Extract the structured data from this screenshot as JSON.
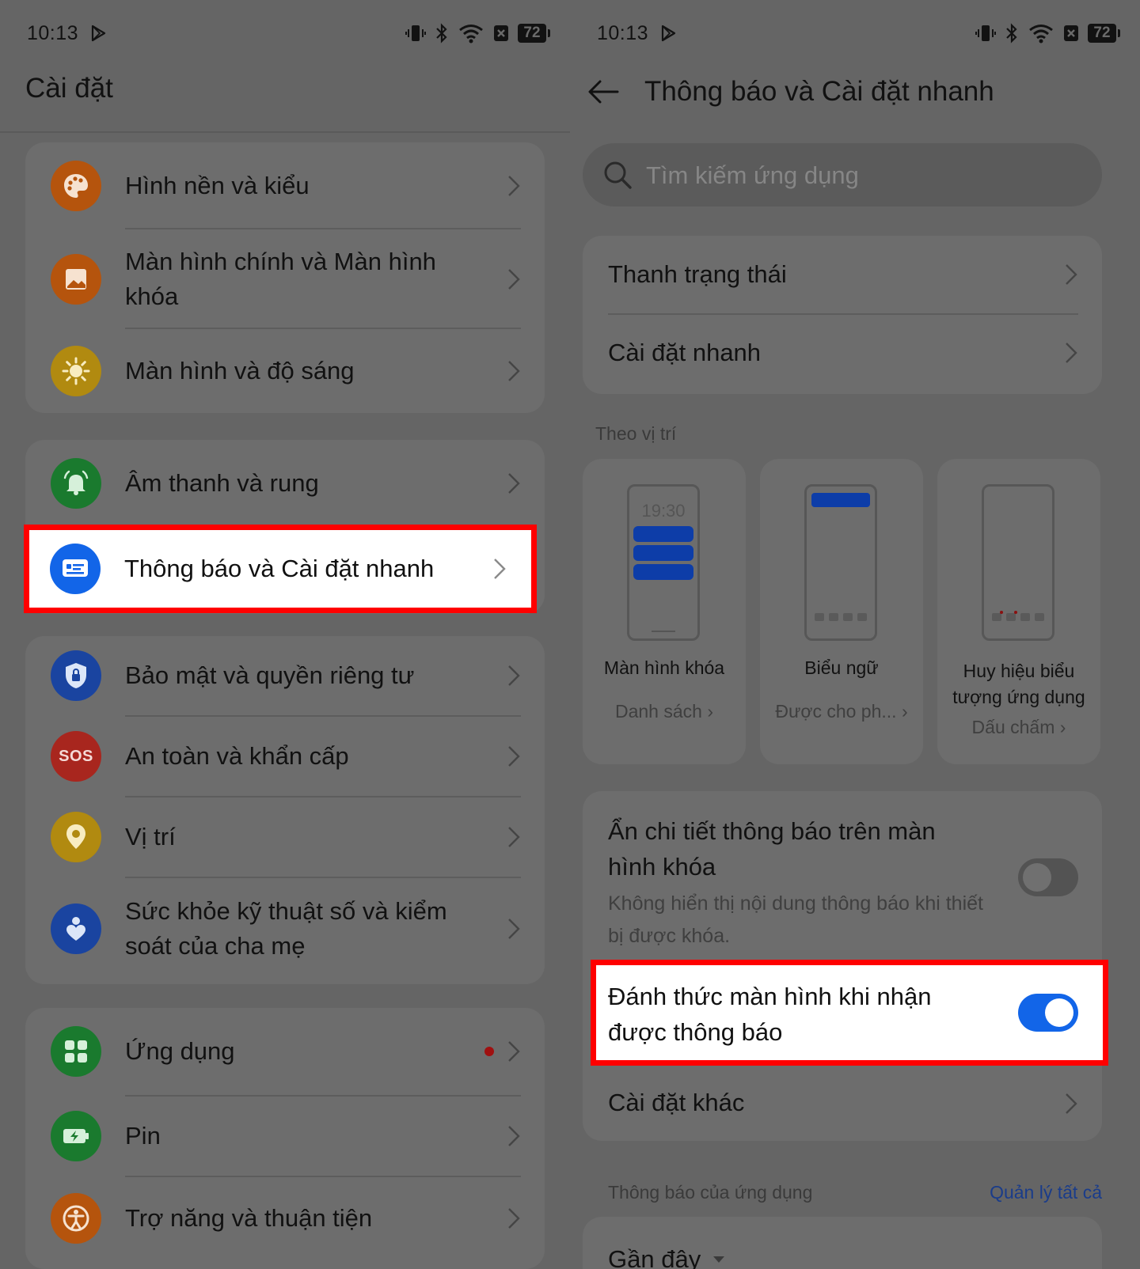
{
  "status": {
    "time": "10:13",
    "battery": "72"
  },
  "left": {
    "title": "Cài đặt",
    "group1": [
      {
        "label": "Hình nền và kiểu",
        "icon": "palette-icon",
        "color": "#b5540d"
      },
      {
        "label": "Màn hình chính và Màn hình khóa",
        "icon": "picture-icon",
        "color": "#b5540d"
      },
      {
        "label": "Màn hình và độ sáng",
        "icon": "sun-icon",
        "color": "#b18a10"
      }
    ],
    "group2": [
      {
        "label": "Âm thanh và rung",
        "icon": "bell-icon",
        "color": "#1a7a2e"
      },
      {
        "label": "Thông báo và Cài đặt nhanh",
        "icon": "notification-icon",
        "color": "#1265e8"
      }
    ],
    "group3": [
      {
        "label": "Bảo mật và quyền riêng tư",
        "icon": "shield-lock-icon",
        "color": "#1a44a0"
      },
      {
        "label": "An toàn và khẩn cấp",
        "icon": "sos-icon",
        "color": "#a8261e",
        "icon_text": "SOS"
      },
      {
        "label": "Vị trí",
        "icon": "location-pin-icon",
        "color": "#b18a10"
      },
      {
        "label": "Sức khỏe kỹ thuật số và kiểm soát của cha mẹ",
        "icon": "heart-person-icon",
        "color": "#1a44a0"
      }
    ],
    "group4": [
      {
        "label": "Ứng dụng",
        "icon": "apps-grid-icon",
        "color": "#1a7a2e",
        "badge_color": "#a01010"
      },
      {
        "label": "Pin",
        "icon": "battery-icon",
        "color": "#1a7a2e"
      },
      {
        "label": "Trợ năng và thuận tiện",
        "icon": "accessibility-icon",
        "color": "#b5540d"
      }
    ]
  },
  "right": {
    "title": "Thông báo và Cài đặt nhanh",
    "search_placeholder": "Tìm kiếm ứng dụng",
    "group1": [
      "Thanh trạng thái",
      "Cài đặt nhanh"
    ],
    "position_header": "Theo vị trí",
    "positions": [
      {
        "title": "Màn hình khóa",
        "sub": "Danh sách",
        "clock": "19:30"
      },
      {
        "title": "Biểu ngữ",
        "sub": "Được cho ph..."
      },
      {
        "title": "Huy hiệu biểu tượng ứng dụng",
        "sub": "Dấu chấm"
      }
    ],
    "hide_details": {
      "title": "Ẩn chi tiết thông báo trên màn hình khóa",
      "desc": "Không hiển thị nội dung thông báo khi thiết bị được khóa.",
      "on": false
    },
    "wake_screen": {
      "title": "Đánh thức màn hình khi nhận được thông báo",
      "on": true
    },
    "other_settings": "Cài đặt khác",
    "app_notifications": {
      "header": "Thông báo của ứng dụng",
      "manage_all": "Quản lý tất cả"
    },
    "recent": "Gần đây"
  },
  "colors": {
    "accent": "#1265e8",
    "highlight": "#ff0000",
    "link": "#1a3c8a"
  }
}
